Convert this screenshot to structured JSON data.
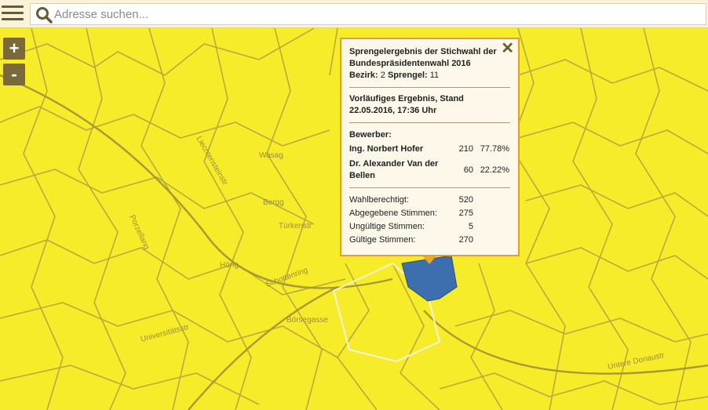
{
  "search": {
    "placeholder": "Adresse suchen..."
  },
  "icons": {
    "menu": "hamburger-menu-icon",
    "search": "search-icon",
    "close": "close-icon"
  },
  "zoom": {
    "in_label": "+",
    "out_label": "-"
  },
  "colors": {
    "map_fill": "#f6ec2a",
    "district_highlight": "#3d6fae",
    "popup_border": "#e0a030"
  },
  "popup": {
    "close_label": "✕",
    "title": "Sprengelergebnis der Stichwahl der Bundespräsidentenwahl 2016",
    "bezirk_label": "Bezirk:",
    "bezirk_value": "2",
    "sprengel_label": "Sprengel:",
    "sprengel_value": "11",
    "status": "Vorläufiges Ergebnis, Stand 22.05.2016, 17:36 Uhr",
    "candidates_heading": "Bewerber:",
    "candidates": [
      {
        "name": "Ing. Norbert Hofer",
        "votes": "210",
        "percent": "77.78%"
      },
      {
        "name": "Dr. Alexander Van der Bellen",
        "votes": "60",
        "percent": "22.22%"
      }
    ],
    "stats": [
      {
        "label": "Wahlberechtigt:",
        "value": "520"
      },
      {
        "label": "Abgegebene Stimmen:",
        "value": "275"
      },
      {
        "label": "Ungültige Stimmen:",
        "value": "5"
      },
      {
        "label": "Gültige Stimmen:",
        "value": "270"
      }
    ]
  },
  "map_labels": [
    "Bergg",
    "Türkenstr",
    "Schottenring",
    "Universitätsstr",
    "Börsegasse",
    "Untere Donaustr",
    "Hörlg",
    "Liechtensteinstr",
    "Wasag",
    "Porzellang"
  ]
}
